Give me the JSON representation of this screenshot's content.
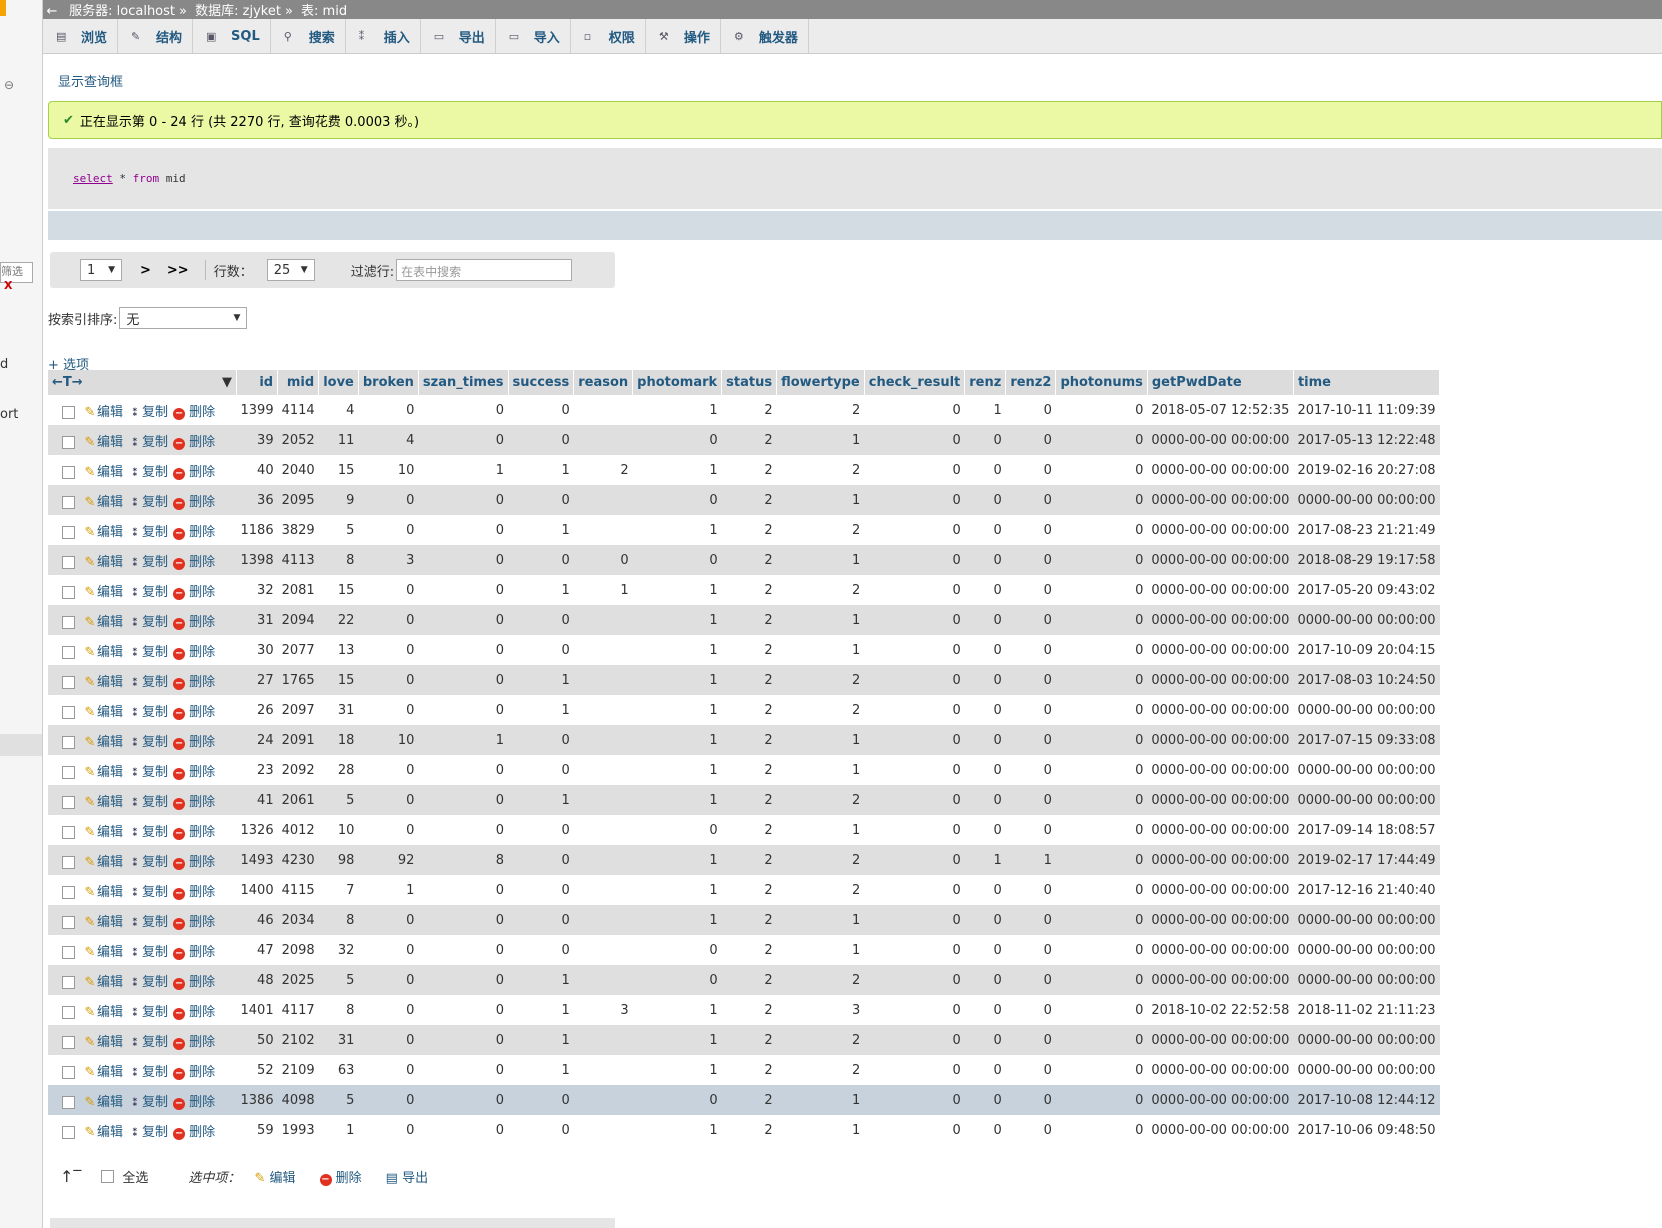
{
  "breadcrumb": {
    "server": "服务器: localhost",
    "database": "数据库: zjyket",
    "table": "表: mid"
  },
  "tabs": [
    {
      "label": "浏览",
      "icon": "browse-icon"
    },
    {
      "label": "结构",
      "icon": "structure-icon"
    },
    {
      "label": "SQL",
      "icon": "sql-icon"
    },
    {
      "label": "搜索",
      "icon": "search-icon"
    },
    {
      "label": "插入",
      "icon": "insert-icon"
    },
    {
      "label": "导出",
      "icon": "export-icon"
    },
    {
      "label": "导入",
      "icon": "import-icon"
    },
    {
      "label": "权限",
      "icon": "privileges-icon"
    },
    {
      "label": "操作",
      "icon": "wrench-icon"
    },
    {
      "label": "触发器",
      "icon": "triggers-icon"
    }
  ],
  "left_pane": {
    "filter_text": "筛选",
    "clear": "X",
    "text_d": "d",
    "text_ort": "ort"
  },
  "show_query_link": "显示查询框",
  "success_message": "正在显示第 0 - 24 行 (共 2270 行, 查询花费 0.0003 秒。)",
  "sql": {
    "k1": "select",
    "star": "*",
    "k2": "from",
    "table": "mid"
  },
  "nav": {
    "page": "1",
    "next": ">",
    "last": ">>",
    "rows_label": "行数：",
    "rows_value": "25",
    "filter_label": "过滤行:",
    "filter_placeholder": "在表中搜索"
  },
  "sort": {
    "label": "按索引排序:",
    "value": "无"
  },
  "options_link": "+ 选项",
  "table": {
    "header_ctrl": "←T→",
    "columns": [
      "id",
      "mid",
      "love",
      "broken",
      "szan_times",
      "success",
      "reason",
      "photomark",
      "status",
      "flowertype",
      "check_result",
      "renz",
      "renz2",
      "photonums",
      "getPwdDate",
      "time"
    ],
    "actions": {
      "edit": "编辑",
      "copy": "复制",
      "delete": "删除"
    },
    "rows": [
      [
        "1399",
        "4114",
        "4",
        "0",
        "0",
        "0",
        "",
        "1",
        "2",
        "2",
        "0",
        "1",
        "0",
        "0",
        "2018-05-07 12:52:35",
        "2017-10-11 11:09:39"
      ],
      [
        "39",
        "2052",
        "11",
        "4",
        "0",
        "0",
        "",
        "0",
        "2",
        "1",
        "0",
        "0",
        "0",
        "0",
        "0000-00-00 00:00:00",
        "2017-05-13 12:22:48"
      ],
      [
        "40",
        "2040",
        "15",
        "10",
        "1",
        "1",
        "2",
        "1",
        "2",
        "2",
        "0",
        "0",
        "0",
        "0",
        "0000-00-00 00:00:00",
        "2019-02-16 20:27:08"
      ],
      [
        "36",
        "2095",
        "9",
        "0",
        "0",
        "0",
        "",
        "0",
        "2",
        "1",
        "0",
        "0",
        "0",
        "0",
        "0000-00-00 00:00:00",
        "0000-00-00 00:00:00"
      ],
      [
        "1186",
        "3829",
        "5",
        "0",
        "0",
        "1",
        "",
        "1",
        "2",
        "2",
        "0",
        "0",
        "0",
        "0",
        "0000-00-00 00:00:00",
        "2017-08-23 21:21:49"
      ],
      [
        "1398",
        "4113",
        "8",
        "3",
        "0",
        "0",
        "0",
        "0",
        "2",
        "1",
        "0",
        "0",
        "0",
        "0",
        "0000-00-00 00:00:00",
        "2018-08-29 19:17:58"
      ],
      [
        "32",
        "2081",
        "15",
        "0",
        "0",
        "1",
        "1",
        "1",
        "2",
        "2",
        "0",
        "0",
        "0",
        "0",
        "0000-00-00 00:00:00",
        "2017-05-20 09:43:02"
      ],
      [
        "31",
        "2094",
        "22",
        "0",
        "0",
        "0",
        "",
        "1",
        "2",
        "1",
        "0",
        "0",
        "0",
        "0",
        "0000-00-00 00:00:00",
        "0000-00-00 00:00:00"
      ],
      [
        "30",
        "2077",
        "13",
        "0",
        "0",
        "0",
        "",
        "1",
        "2",
        "1",
        "0",
        "0",
        "0",
        "0",
        "0000-00-00 00:00:00",
        "2017-10-09 20:04:15"
      ],
      [
        "27",
        "1765",
        "15",
        "0",
        "0",
        "1",
        "",
        "1",
        "2",
        "2",
        "0",
        "0",
        "0",
        "0",
        "0000-00-00 00:00:00",
        "2017-08-03 10:24:50"
      ],
      [
        "26",
        "2097",
        "31",
        "0",
        "0",
        "1",
        "",
        "1",
        "2",
        "2",
        "0",
        "0",
        "0",
        "0",
        "0000-00-00 00:00:00",
        "0000-00-00 00:00:00"
      ],
      [
        "24",
        "2091",
        "18",
        "10",
        "1",
        "0",
        "",
        "1",
        "2",
        "1",
        "0",
        "0",
        "0",
        "0",
        "0000-00-00 00:00:00",
        "2017-07-15 09:33:08"
      ],
      [
        "23",
        "2092",
        "28",
        "0",
        "0",
        "0",
        "",
        "1",
        "2",
        "1",
        "0",
        "0",
        "0",
        "0",
        "0000-00-00 00:00:00",
        "0000-00-00 00:00:00"
      ],
      [
        "41",
        "2061",
        "5",
        "0",
        "0",
        "1",
        "",
        "1",
        "2",
        "2",
        "0",
        "0",
        "0",
        "0",
        "0000-00-00 00:00:00",
        "0000-00-00 00:00:00"
      ],
      [
        "1326",
        "4012",
        "10",
        "0",
        "0",
        "0",
        "",
        "0",
        "2",
        "1",
        "0",
        "0",
        "0",
        "0",
        "0000-00-00 00:00:00",
        "2017-09-14 18:08:57"
      ],
      [
        "1493",
        "4230",
        "98",
        "92",
        "8",
        "0",
        "",
        "1",
        "2",
        "2",
        "0",
        "1",
        "1",
        "0",
        "0000-00-00 00:00:00",
        "2019-02-17 17:44:49"
      ],
      [
        "1400",
        "4115",
        "7",
        "1",
        "0",
        "0",
        "",
        "1",
        "2",
        "2",
        "0",
        "0",
        "0",
        "0",
        "0000-00-00 00:00:00",
        "2017-12-16 21:40:40"
      ],
      [
        "46",
        "2034",
        "8",
        "0",
        "0",
        "0",
        "",
        "1",
        "2",
        "1",
        "0",
        "0",
        "0",
        "0",
        "0000-00-00 00:00:00",
        "0000-00-00 00:00:00"
      ],
      [
        "47",
        "2098",
        "32",
        "0",
        "0",
        "0",
        "",
        "0",
        "2",
        "1",
        "0",
        "0",
        "0",
        "0",
        "0000-00-00 00:00:00",
        "0000-00-00 00:00:00"
      ],
      [
        "48",
        "2025",
        "5",
        "0",
        "0",
        "1",
        "",
        "0",
        "2",
        "2",
        "0",
        "0",
        "0",
        "0",
        "0000-00-00 00:00:00",
        "0000-00-00 00:00:00"
      ],
      [
        "1401",
        "4117",
        "8",
        "0",
        "0",
        "1",
        "3",
        "1",
        "2",
        "3",
        "0",
        "0",
        "0",
        "0",
        "2018-10-02 22:52:58",
        "2018-11-02 21:11:23"
      ],
      [
        "50",
        "2102",
        "31",
        "0",
        "0",
        "1",
        "",
        "1",
        "2",
        "2",
        "0",
        "0",
        "0",
        "0",
        "0000-00-00 00:00:00",
        "0000-00-00 00:00:00"
      ],
      [
        "52",
        "2109",
        "63",
        "0",
        "0",
        "1",
        "",
        "1",
        "2",
        "2",
        "0",
        "0",
        "0",
        "0",
        "0000-00-00 00:00:00",
        "0000-00-00 00:00:00"
      ],
      [
        "1386",
        "4098",
        "5",
        "0",
        "0",
        "0",
        "",
        "0",
        "2",
        "1",
        "0",
        "0",
        "0",
        "0",
        "0000-00-00 00:00:00",
        "2017-10-08 12:44:12"
      ],
      [
        "59",
        "1993",
        "1",
        "0",
        "0",
        "0",
        "",
        "1",
        "2",
        "1",
        "0",
        "0",
        "0",
        "0",
        "0000-00-00 00:00:00",
        "2017-10-06 09:48:50"
      ]
    ]
  },
  "footer": {
    "check_all": "全选",
    "with_selected": "选中项：",
    "edit": "编辑",
    "delete": "删除",
    "export": "导出"
  }
}
